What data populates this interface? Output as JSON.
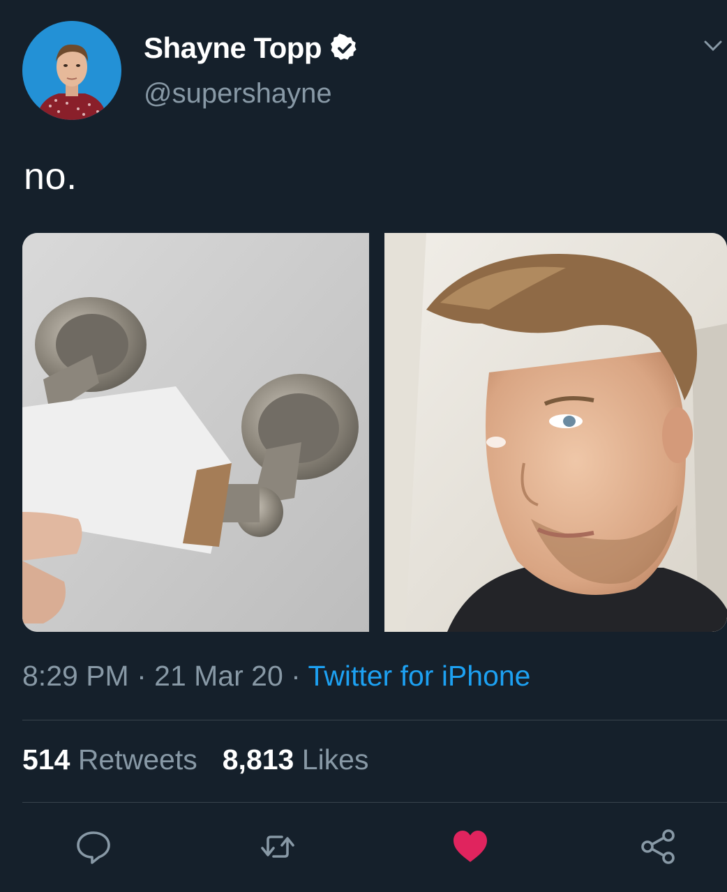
{
  "author": {
    "display_name": "Shayne Topp",
    "handle": "@supershayne",
    "verified": true,
    "avatar_icon": "avatar-photo"
  },
  "tweet": {
    "text": "no.",
    "media": [
      {
        "icon": "toilet-paper-roll-photo"
      },
      {
        "icon": "man-selfie-photo"
      }
    ]
  },
  "meta": {
    "time": "8:29 PM",
    "separator_1": " · ",
    "date": "21 Mar 20",
    "separator_2": " · ",
    "source": "Twitter for iPhone"
  },
  "stats": {
    "retweets_count": "514",
    "retweets_label": "Retweets",
    "likes_count": "8,813",
    "likes_label": "Likes"
  },
  "actions": {
    "reply_icon": "reply-icon",
    "retweet_icon": "retweet-icon",
    "like_icon": "heart-icon",
    "share_icon": "share-icon"
  },
  "colors": {
    "background": "#15202b",
    "secondary_text": "#8899a6",
    "link": "#1da1f2",
    "like": "#e0245e"
  }
}
